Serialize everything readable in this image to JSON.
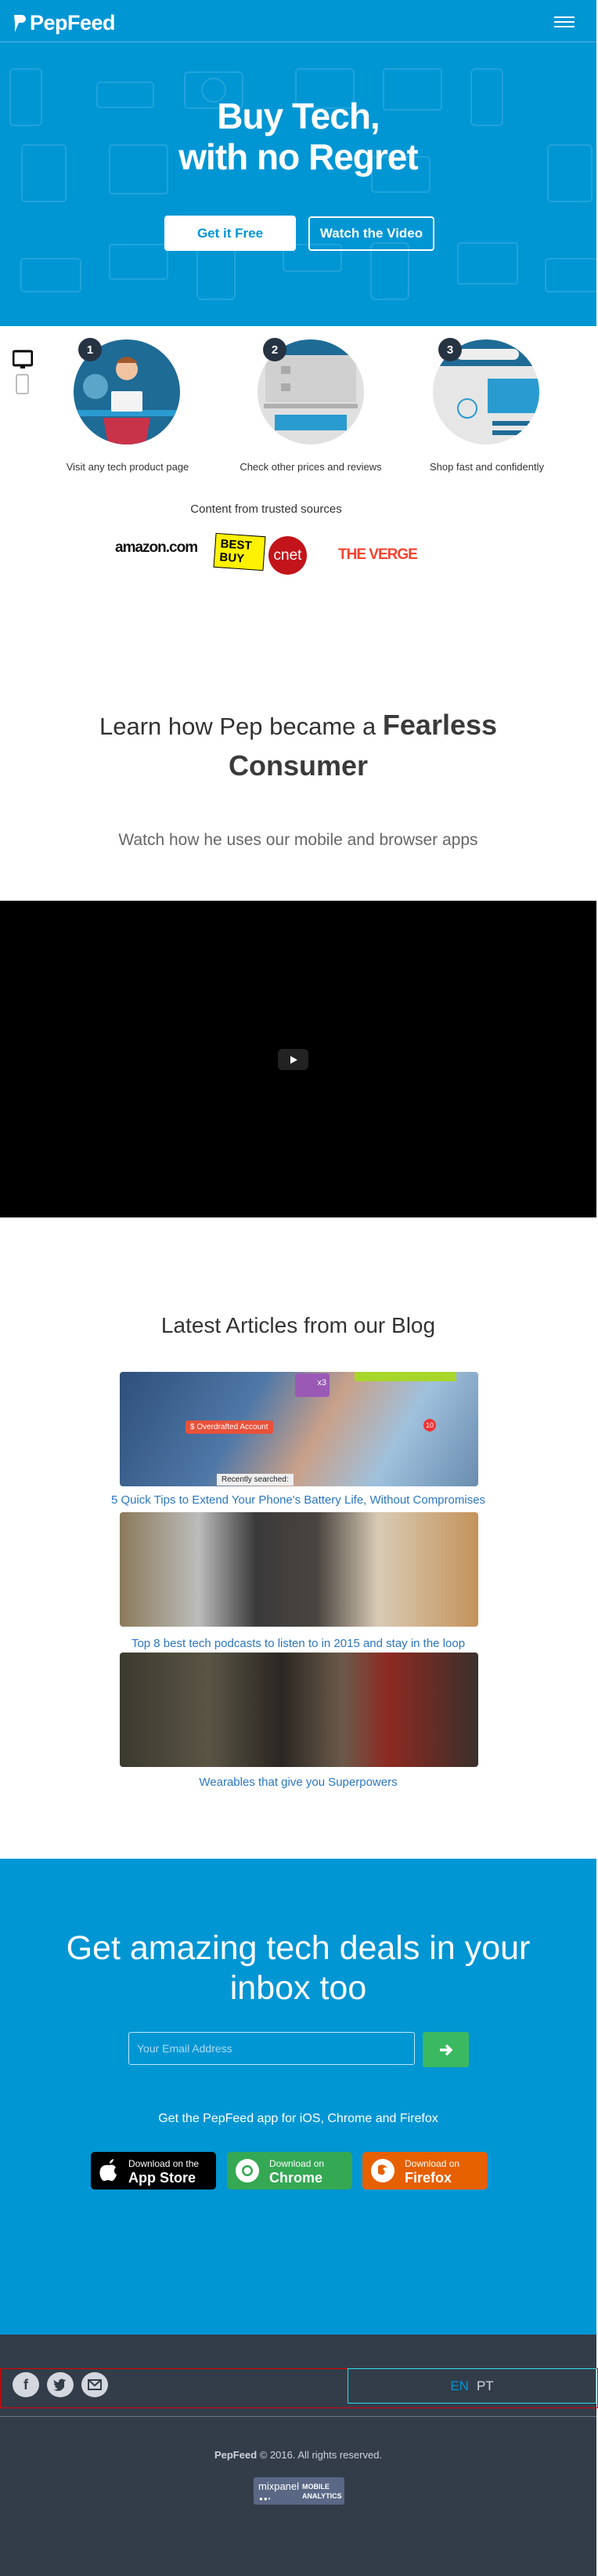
{
  "colors": {
    "brand_blue": "#0096d4",
    "footer_bg": "#333d4a",
    "link_blue": "#2b77c0",
    "submit_green": "#3bb960",
    "chrome_green": "#34a853",
    "firefox_orange": "#e66000"
  },
  "header": {
    "logo": "PepFeed",
    "menu_icon": "hamburger-icon"
  },
  "hero": {
    "title_line1": "Buy Tech,",
    "title_line2": "with no Regret",
    "cta_primary": "Get it Free",
    "cta_secondary": "Watch the Video"
  },
  "device_toggle": [
    "desktop-icon",
    "phone-icon"
  ],
  "steps": [
    {
      "number": "1",
      "label": "Visit any tech product page"
    },
    {
      "number": "2",
      "label": "Check other prices and reviews"
    },
    {
      "number": "3",
      "label": "Shop fast and confidently"
    }
  ],
  "sources": {
    "title": "Content from trusted sources",
    "logos": [
      "amazon.com",
      "BEST BUY",
      "cnet",
      "THE VERGE"
    ]
  },
  "pep": {
    "title_regular": "Learn how Pep became a",
    "title_bold_1": "Fearless",
    "title_bold_2": "Consumer",
    "subtitle": "Watch how he uses our mobile and browser apps"
  },
  "video": {
    "play_icon": "play-icon"
  },
  "blog": {
    "title": "Latest Articles from our Blog",
    "articles": [
      {
        "title": "5 Quick Tips to Extend Your Phone's Battery Life, Without Compromises",
        "image_text_1": "$ Overdrafted Account",
        "image_text_2": "Recently searched:",
        "image_text_3": "x3",
        "image_text_4": "10"
      },
      {
        "title": "Top 8 best tech podcasts to listen to in 2015 and stay in the loop"
      },
      {
        "title": "Wearables that give you Superpowers"
      }
    ]
  },
  "newsletter": {
    "title_line1": "Get amazing tech deals in your",
    "title_line2": "inbox too",
    "email_placeholder": "Your Email Address",
    "submit_icon": "arrow-right-icon",
    "apps_text": "Get the PepFeed app for iOS, Chrome and Firefox",
    "badges": [
      {
        "small": "Download on the",
        "large": "App Store"
      },
      {
        "small": "Download on",
        "large": "Chrome"
      },
      {
        "small": "Download on",
        "large": "Firefox"
      }
    ]
  },
  "footer": {
    "social": [
      "facebook-icon",
      "twitter-icon",
      "email-icon"
    ],
    "languages": {
      "active": "EN",
      "other": "PT"
    },
    "copyright_brand": "PepFeed",
    "copyright_text": "© 2016. All rights reserved.",
    "mixpanel": {
      "name": "mixpanel",
      "line1": "MOBILE",
      "line2": "ANALYTICS"
    }
  }
}
